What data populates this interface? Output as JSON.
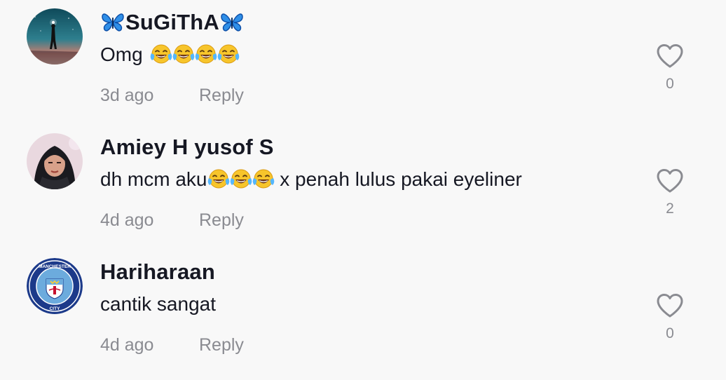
{
  "comments": [
    {
      "username": "SuGiThA",
      "username_decor": "butterfly-emoji",
      "text": "Omg",
      "emoji_after_text": [
        "face-with-tears-of-joy",
        "face-with-tears-of-joy",
        "face-with-tears-of-joy",
        "face-with-tears-of-joy"
      ],
      "date": "3d ago",
      "reply_label": "Reply",
      "like_count": "0",
      "avatar": "silhouette-starry-sky-avatar"
    },
    {
      "username": "Amiey H yusof S",
      "text_before_emoji": "dh mcm aku",
      "emoji_inline": [
        "face-with-tears-of-joy",
        "face-with-tears-of-joy",
        "face-with-tears-of-joy"
      ],
      "text_after_emoji": " x penah lulus pakai eyeliner",
      "date": "4d ago",
      "reply_label": "Reply",
      "like_count": "2",
      "avatar": "hijab-woman-portrait-avatar"
    },
    {
      "username": "Hariharaan",
      "text": "cantik sangat",
      "date": "4d ago",
      "reply_label": "Reply",
      "like_count": "0",
      "avatar": "manchester-city-crest-avatar",
      "avatar_text": [
        "MANCHESTER",
        "CITY"
      ]
    }
  ],
  "colors": {
    "background": "#f8f8f8",
    "primary_text": "#161823",
    "secondary_text": "#8a8b91",
    "heart_outline": "#8a8b91",
    "city_blue": "#1c3a8a"
  }
}
